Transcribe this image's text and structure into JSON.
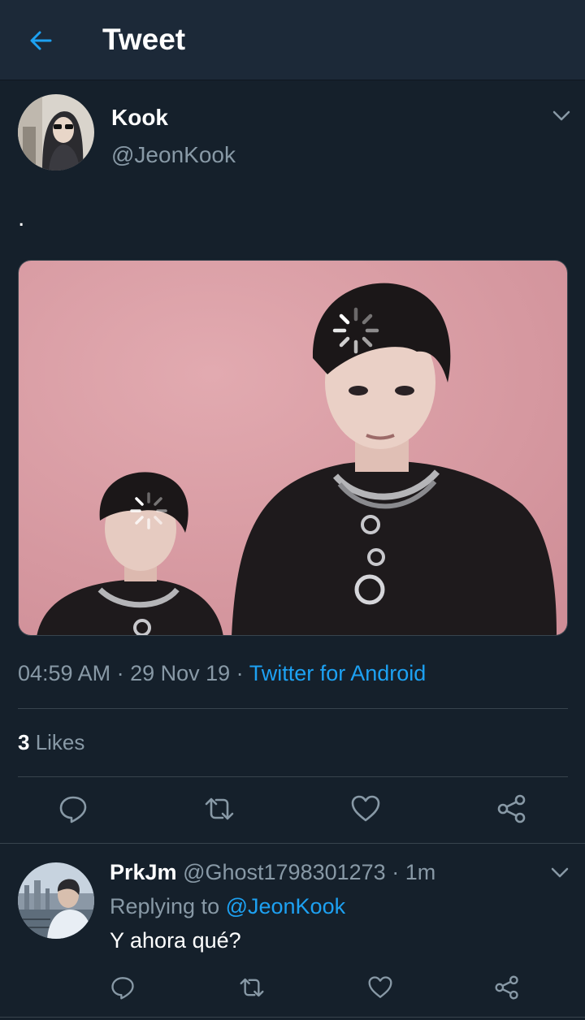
{
  "header": {
    "title": "Tweet"
  },
  "tweet": {
    "author_name": "Kook",
    "author_handle": "@JeonKook",
    "text": ".",
    "time": "04:59 AM",
    "date": "29 Nov 19",
    "separator": " · ",
    "source": "Twitter for Android",
    "likes_count": "3",
    "likes_label": " Likes"
  },
  "reply": {
    "author_name": "PrkJm",
    "author_handle": "@Ghost1798301273",
    "time_ago": "1m",
    "replying_prefix": "Replying to ",
    "replying_to": "@JeonKook",
    "text": "Y ahora qué?"
  },
  "colors": {
    "background": "#15202b",
    "header": "#1c2938",
    "accent": "#1da1f2",
    "secondary_text": "#8899a6",
    "border": "#38444d"
  },
  "icons": [
    "back-arrow-icon",
    "chevron-down-icon",
    "reply-icon",
    "retweet-icon",
    "like-icon",
    "share-icon",
    "loading-spinner-icon"
  ]
}
